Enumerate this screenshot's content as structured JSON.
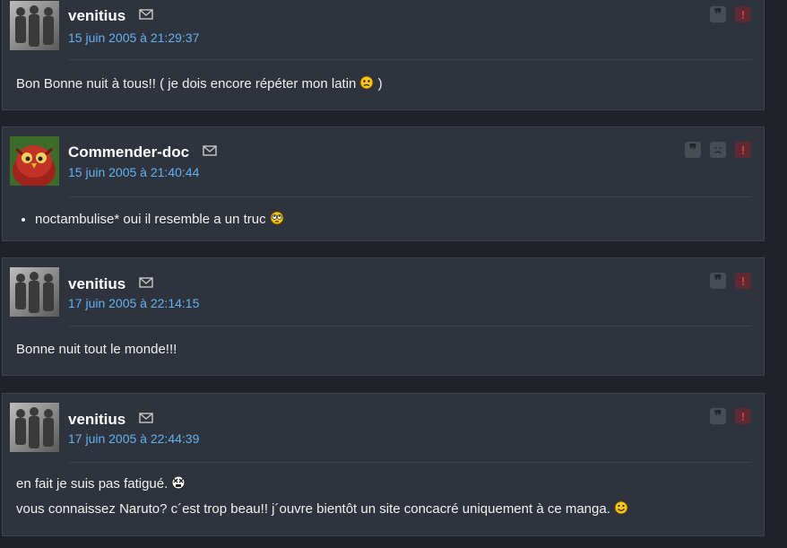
{
  "posts": [
    {
      "author": "venitius",
      "date": "15 juin 2005 à 21:29:37",
      "avatar": "silhouettes-avatar",
      "lines": [
        "Bon Bonne nuit à tous!! ( je dois encore répéter mon latin",
        ")"
      ],
      "actions": [
        "quote-icon",
        "report-icon"
      ]
    },
    {
      "author": "Commender-doc",
      "date": "15 juin 2005 à 21:40:44",
      "avatar": "owl-avatar",
      "bullet": "noctambulise* oui il resemble a un truc",
      "actions": [
        "quote-icon",
        "frown-icon",
        "report-icon"
      ]
    },
    {
      "author": "venitius",
      "date": "17 juin 2005 à 22:14:15",
      "avatar": "silhouettes-avatar",
      "lines": [
        "Bonne nuit tout le monde!!!"
      ],
      "actions": [
        "quote-icon",
        "report-icon"
      ]
    },
    {
      "author": "venitius",
      "date": "17 juin 2005 à 22:44:39",
      "avatar": "silhouettes-avatar",
      "lines": [
        "en fait je suis pas fatigué.",
        "vous connaissez Naruto? c´est trop beau!! j´ouvre bientôt un site concacré uniquement à ce manga."
      ],
      "actions": [
        "quote-icon",
        "report-icon"
      ]
    }
  ],
  "icons": {
    "quote": "❞",
    "report": "!"
  },
  "colors": {
    "background": "#1f2228",
    "panel": "#2e333d",
    "date": "#5fb3f0",
    "report": "#e23a44"
  }
}
